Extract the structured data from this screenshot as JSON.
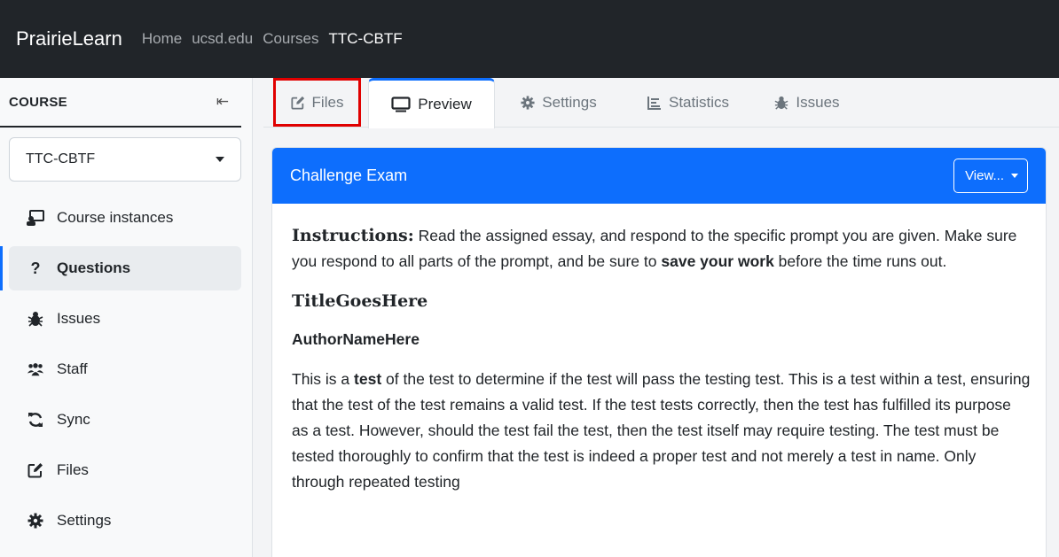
{
  "topnav": {
    "brand": "PrairieLearn",
    "links": [
      "Home",
      "ucsd.edu",
      "Courses",
      "TTC-CBTF"
    ]
  },
  "sidebar": {
    "heading": "COURSE",
    "collapse_glyph": "⇤",
    "course_select": "TTC-CBTF",
    "items": [
      {
        "label": "Course instances",
        "icon": "chalkboard-user-icon"
      },
      {
        "label": "Questions",
        "icon": "question-icon",
        "active": true
      },
      {
        "label": "Issues",
        "icon": "bug-icon"
      },
      {
        "label": "Staff",
        "icon": "users-icon"
      },
      {
        "label": "Sync",
        "icon": "sync-icon"
      },
      {
        "label": "Files",
        "icon": "edit-icon"
      },
      {
        "label": "Settings",
        "icon": "gear-icon"
      }
    ]
  },
  "tabs": [
    {
      "label": "Files",
      "icon": "edit-icon",
      "highlighted": true
    },
    {
      "label": "Preview",
      "icon": "monitor-icon",
      "active": true
    },
    {
      "label": "Settings",
      "icon": "gear-icon"
    },
    {
      "label": "Statistics",
      "icon": "chart-icon"
    },
    {
      "label": "Issues",
      "icon": "bug-icon"
    }
  ],
  "card": {
    "title": "Challenge Exam",
    "view_button": "View...",
    "instructions_label": "Instructions:",
    "instructions_text_a": " Read the assigned essay, and respond to the specific prompt you are given. Make sure you respond to all parts of the prompt, and be sure to ",
    "instructions_bold": "save your work",
    "instructions_text_b": " before the time runs out.",
    "essay_title": "TitleGoesHere",
    "author": "AuthorNameHere",
    "body_a": "This is a ",
    "body_bold": "test",
    "body_b": " of the test to determine if the test will pass the testing test. This is a test within a test, ensuring that the test of the test remains a valid test. If the test tests correctly, then the test has fulfilled its purpose as a test. However, should the test fail the test, then the test itself may require testing. The test must be tested thoroughly to confirm that the test is indeed a proper test and not merely a test in name. Only through repeated testing"
  },
  "colors": {
    "navbar": "#212529",
    "primary": "#0d6efd",
    "highlight": "#e00000"
  }
}
